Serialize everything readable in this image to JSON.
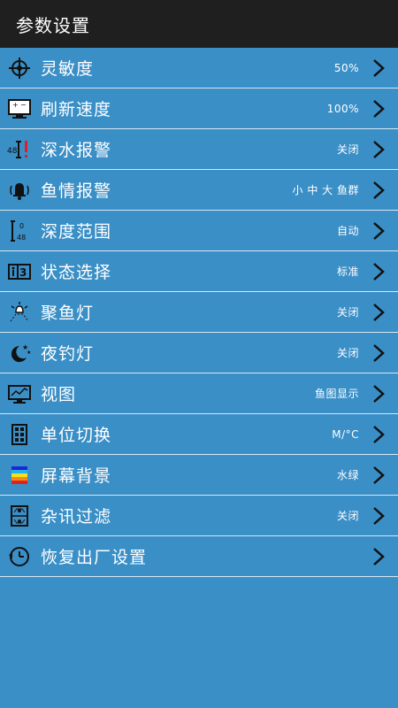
{
  "header": {
    "title": "参数设置"
  },
  "settings": [
    {
      "label": "灵敏度",
      "value": "50%",
      "icon": "target-icon"
    },
    {
      "label": "刷新速度",
      "value": "100%",
      "icon": "monitor-plus-minus-icon"
    },
    {
      "label": "深水报警",
      "value": "关闭",
      "icon": "depth-alarm-icon"
    },
    {
      "label": "鱼情报警",
      "value": "小 中 大 鱼群",
      "icon": "bell-icon"
    },
    {
      "label": "深度范围",
      "value": "自动",
      "icon": "depth-range-icon"
    },
    {
      "label": "状态选择",
      "value": "标准",
      "icon": "mode-select-icon"
    },
    {
      "label": "聚鱼灯",
      "value": "关闭",
      "icon": "fish-lamp-icon"
    },
    {
      "label": "夜钓灯",
      "value": "关闭",
      "icon": "moon-icon"
    },
    {
      "label": "视图",
      "value": "鱼图显示",
      "icon": "screen-view-icon"
    },
    {
      "label": "单位切换",
      "value": "M/°C",
      "icon": "units-grid-icon"
    },
    {
      "label": "屏幕背景",
      "value": "水绿",
      "icon": "color-palette-icon"
    },
    {
      "label": "杂讯过滤",
      "value": "关闭",
      "icon": "noise-filter-icon"
    },
    {
      "label": "恢复出厂设置",
      "value": "",
      "icon": "clock-reset-icon"
    }
  ],
  "colors": {
    "header_bg": "#1f1f1f",
    "list_bg": "#3a8fc7",
    "divider": "#d8e7f2"
  }
}
